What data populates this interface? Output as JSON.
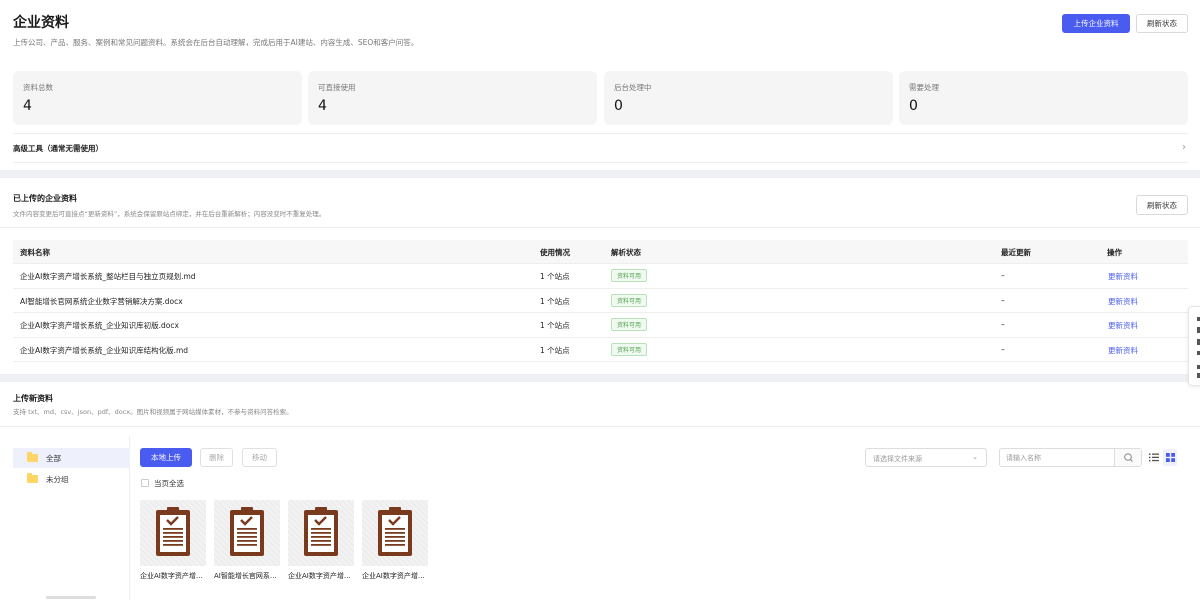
{
  "header": {
    "title": "企业资料",
    "description": "上传公司、产品、服务、案例和常见问题资料。系统会在后台自动理解，完成后用于AI建站、内容生成、SEO和客户问答。",
    "upload_button": "上传企业资料",
    "refresh_button": "刷新状态"
  },
  "stats": [
    {
      "label": "资料总数",
      "value": "4"
    },
    {
      "label": "可直接使用",
      "value": "4"
    },
    {
      "label": "后台处理中",
      "value": "0"
    },
    {
      "label": "需要处理",
      "value": "0"
    }
  ],
  "advanced_tools": {
    "label": "高级工具（通常无需使用）",
    "icon": "chevron-right-icon"
  },
  "uploaded": {
    "title": "已上传的企业资料",
    "description": "文件内容变更后可直接点“更新资料”，系统会保留原站点绑定，并在后台重新解析；内容没变时不重复处理。",
    "refresh_button": "刷新状态",
    "columns": [
      "资料名称",
      "使用情况",
      "解析状态",
      "最近更新",
      "操作"
    ],
    "rows": [
      {
        "name": "企业AI数字资产增长系统_整站栏目与独立页规划.md",
        "usage": "1 个站点",
        "status": "资料可用",
        "updated": "–",
        "action": "更新资料"
      },
      {
        "name": "AI智能增长官网系统企业数字营销解决方案.docx",
        "usage": "1 个站点",
        "status": "资料可用",
        "updated": "–",
        "action": "更新资料"
      },
      {
        "name": "企业AI数字资产增长系统_企业知识库初版.docx",
        "usage": "1 个站点",
        "status": "资料可用",
        "updated": "–",
        "action": "更新资料"
      },
      {
        "name": "企业AI数字资产增长系统_企业知识库结构化版.md",
        "usage": "1 个站点",
        "status": "资料可用",
        "updated": "–",
        "action": "更新资料"
      }
    ]
  },
  "upload_new": {
    "title": "上传新资料",
    "description": "支持 txt、md、csv、json、pdf、docx。图片和视频属于网站媒体素材，不参与资料问答检索。",
    "tree": [
      {
        "label": "全部",
        "icon": "folder-icon"
      },
      {
        "label": "未分组",
        "icon": "folder-icon"
      }
    ],
    "buttons": {
      "local_upload": "本地上传",
      "delete": "删除",
      "move": "移动"
    },
    "select_all": "当页全选",
    "source_placeholder": "请选择文件来源",
    "search_placeholder": "请输入名称",
    "files": [
      {
        "name": "企业AI数字资产增长系统_整站栏目与独立页规划.md",
        "icon": "clipboard-icon"
      },
      {
        "name": "AI智能增长官网系统企业数字营销解决方案.docx",
        "icon": "clipboard-icon"
      },
      {
        "name": "企业AI数字资产增长系统_企业知识库初版.docx",
        "icon": "clipboard-icon"
      },
      {
        "name": "企业AI数字资产增长系统_企业知识库结构化版.md",
        "icon": "clipboard-icon"
      }
    ]
  },
  "colors": {
    "primary": "#4a5cf0",
    "success": "#52a352",
    "folder": "#ffd666",
    "clipboard": "#7a3a1e"
  }
}
